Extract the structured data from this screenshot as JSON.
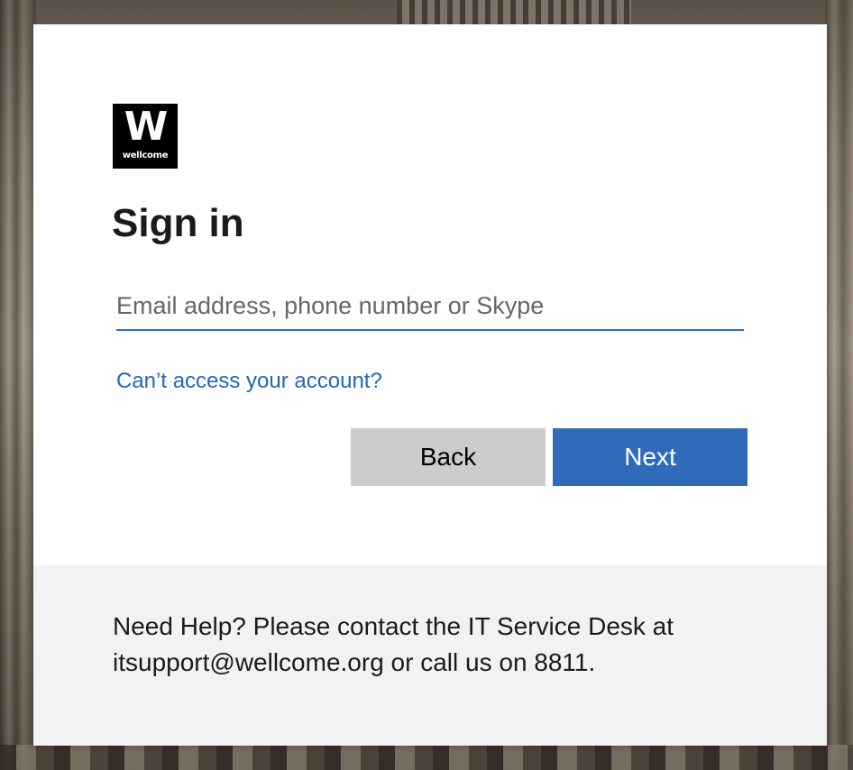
{
  "logo": {
    "letter": "W",
    "wordmark": "wellcome"
  },
  "form": {
    "title": "Sign in",
    "email_placeholder": "Email address, phone number or Skype",
    "email_value": "",
    "cant_access_link": "Can’t access your account?",
    "back_label": "Back",
    "next_label": "Next"
  },
  "footer": {
    "help_line1": "Need Help? Please contact the IT Service Desk at",
    "help_line2": "itsupport@wellcome.org or call us on 8811."
  },
  "colors": {
    "accent": "#2f6bb8",
    "link": "#2467b4",
    "back_button": "#cccccc",
    "footer_bg": "#f2f2f2"
  }
}
